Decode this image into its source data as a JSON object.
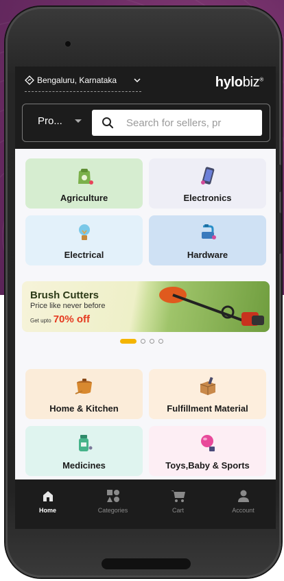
{
  "header": {
    "location": "Bengaluru, Karnataka",
    "logo": {
      "bold": "hylo",
      "light": "biz",
      "mark": "®"
    },
    "dropdown_label": "Pro...",
    "search_placeholder": "Search for sellers, pr"
  },
  "categories_top": [
    {
      "label": "Agriculture",
      "icon": "fertilizer-bag-icon",
      "bg": "#d6edd0"
    },
    {
      "label": "Electronics",
      "icon": "smartphone-icon",
      "bg": "#eeeef6"
    },
    {
      "label": "Electrical",
      "icon": "light-bulb-icon",
      "bg": "#e3f1fa"
    },
    {
      "label": "Hardware",
      "icon": "water-tap-icon",
      "bg": "#cfe1f4"
    }
  ],
  "banner": {
    "title": "Brush Cutters",
    "subtitle": "Price like never before",
    "offer_prefix": "Get upto",
    "offer_value": "70% off"
  },
  "carousel": {
    "count": 4,
    "active": 0
  },
  "categories_bottom": [
    {
      "label": "Home & Kitchen",
      "icon": "cooking-pot-icon",
      "bg": "#fbecd9"
    },
    {
      "label": "Fulfillment Material",
      "icon": "cardboard-box-icon",
      "bg": "#fdeedd"
    },
    {
      "label": "Medicines",
      "icon": "medicine-bottle-icon",
      "bg": "#dff4ef"
    },
    {
      "label": "Toys,Baby & Sports",
      "icon": "toy-ball-icon",
      "bg": "#fdeef4"
    }
  ],
  "nav": [
    {
      "label": "Home",
      "icon": "home-icon",
      "active": true
    },
    {
      "label": "Categories",
      "icon": "categories-icon",
      "active": false
    },
    {
      "label": "Cart",
      "icon": "cart-icon",
      "active": false
    },
    {
      "label": "Account",
      "icon": "account-icon",
      "active": false
    }
  ],
  "colors": {
    "accent": "#f4b400",
    "offer": "#e5391f",
    "header_bg": "#1c1c1c"
  }
}
